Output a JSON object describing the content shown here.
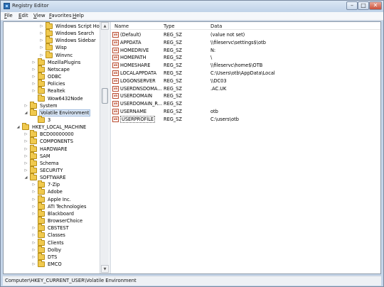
{
  "window": {
    "title": "Registry Editor",
    "min_label": "–",
    "max_label": "□",
    "close_label": "✕"
  },
  "menu": [
    {
      "key": "F",
      "rest": "ile"
    },
    {
      "key": "E",
      "rest": "dit"
    },
    {
      "key": "V",
      "rest": "iew"
    },
    {
      "key": "F",
      "rest": "avorites"
    },
    {
      "key": "H",
      "rest": "elp"
    }
  ],
  "tree": [
    {
      "label": "Windows Script Host",
      "depth": 3,
      "exp": "▷"
    },
    {
      "label": "Windows Search",
      "depth": 3,
      "exp": "▷"
    },
    {
      "label": "Windows Sidebar",
      "depth": 3,
      "exp": "▷"
    },
    {
      "label": "Wisp",
      "depth": 3,
      "exp": "▷"
    },
    {
      "label": "Winvnc",
      "depth": 3,
      "exp": "▷"
    },
    {
      "label": "MozillaPlugins",
      "depth": 2,
      "exp": "▷"
    },
    {
      "label": "Netscape",
      "depth": 2,
      "exp": "▷"
    },
    {
      "label": "ODBC",
      "depth": 2,
      "exp": "▷"
    },
    {
      "label": "Policies",
      "depth": 2,
      "exp": "▷"
    },
    {
      "label": "Realtek",
      "depth": 2,
      "exp": "▷"
    },
    {
      "label": "Wow6432Node",
      "depth": 2,
      "exp": ""
    },
    {
      "label": "System",
      "depth": 1,
      "exp": "▷"
    },
    {
      "label": "Volatile Environment",
      "depth": 1,
      "exp": "◢",
      "selected": true
    },
    {
      "label": "3",
      "depth": 2,
      "exp": ""
    },
    {
      "label": "HKEY_LOCAL_MACHINE",
      "depth": 0,
      "exp": "◢"
    },
    {
      "label": "BCD00000000",
      "depth": 1,
      "exp": "▷"
    },
    {
      "label": "COMPONENTS",
      "depth": 1,
      "exp": "▷"
    },
    {
      "label": "HARDWARE",
      "depth": 1,
      "exp": "▷"
    },
    {
      "label": "SAM",
      "depth": 1,
      "exp": "▷"
    },
    {
      "label": "Schema",
      "depth": 1,
      "exp": "▷"
    },
    {
      "label": "SECURITY",
      "depth": 1,
      "exp": "▷"
    },
    {
      "label": "SOFTWARE",
      "depth": 1,
      "exp": "◢"
    },
    {
      "label": "7-Zip",
      "depth": 2,
      "exp": "▷"
    },
    {
      "label": "Adobe",
      "depth": 2,
      "exp": "▷"
    },
    {
      "label": "Apple Inc.",
      "depth": 2,
      "exp": "▷"
    },
    {
      "label": "ATI Technologies",
      "depth": 2,
      "exp": "▷"
    },
    {
      "label": "Blackboard",
      "depth": 2,
      "exp": "▷"
    },
    {
      "label": "BrowserChoice",
      "depth": 2,
      "exp": ""
    },
    {
      "label": "CBSTEST",
      "depth": 2,
      "exp": "▷"
    },
    {
      "label": "Classes",
      "depth": 2,
      "exp": "▷"
    },
    {
      "label": "Clients",
      "depth": 2,
      "exp": "▷"
    },
    {
      "label": "Dolby",
      "depth": 2,
      "exp": "▷"
    },
    {
      "label": "DTS",
      "depth": 2,
      "exp": "▷"
    },
    {
      "label": "EMCO",
      "depth": 2,
      "exp": "▷"
    }
  ],
  "columns": {
    "name": "Name",
    "type": "Type",
    "data": "Data"
  },
  "values": [
    {
      "name": "(Default)",
      "type": "REG_SZ",
      "data": "(value not set)"
    },
    {
      "name": "APPDATA",
      "type": "REG_SZ",
      "data": "\\\\fileservc\\settings$\\otb"
    },
    {
      "name": "HOMEDRIVE",
      "type": "REG_SZ",
      "data": "N:"
    },
    {
      "name": "HOMEPATH",
      "type": "REG_SZ",
      "data": "\\"
    },
    {
      "name": "HOMESHARE",
      "type": "REG_SZ",
      "data": "\\\\fileservc\\home$\\OTB"
    },
    {
      "name": "LOCALAPPDATA",
      "type": "REG_SZ",
      "data": "C:\\Users\\otb\\AppData\\Local"
    },
    {
      "name": "LOGONSERVER",
      "type": "REG_SZ",
      "data": "\\\\DC03"
    },
    {
      "name": "USERDNSDOMA...",
      "type": "REG_SZ",
      "data": ".AC.UK"
    },
    {
      "name": "USERDOMAIN",
      "type": "REG_SZ",
      "data": ""
    },
    {
      "name": "USERDOMAIN_R...",
      "type": "REG_SZ",
      "data": ""
    },
    {
      "name": "USERNAME",
      "type": "REG_SZ",
      "data": "otb"
    },
    {
      "name": "USERPROFILE",
      "type": "REG_SZ",
      "data": "C:\\users\\otb",
      "focused": true
    }
  ],
  "value_icon": "ab",
  "status": "Computer\\HKEY_CURRENT_USER\\Volatile Environment",
  "colors": {
    "folder": "#f0c94e",
    "selection": "#dbe8f7",
    "title_gradient_top": "#dbe7f4"
  }
}
